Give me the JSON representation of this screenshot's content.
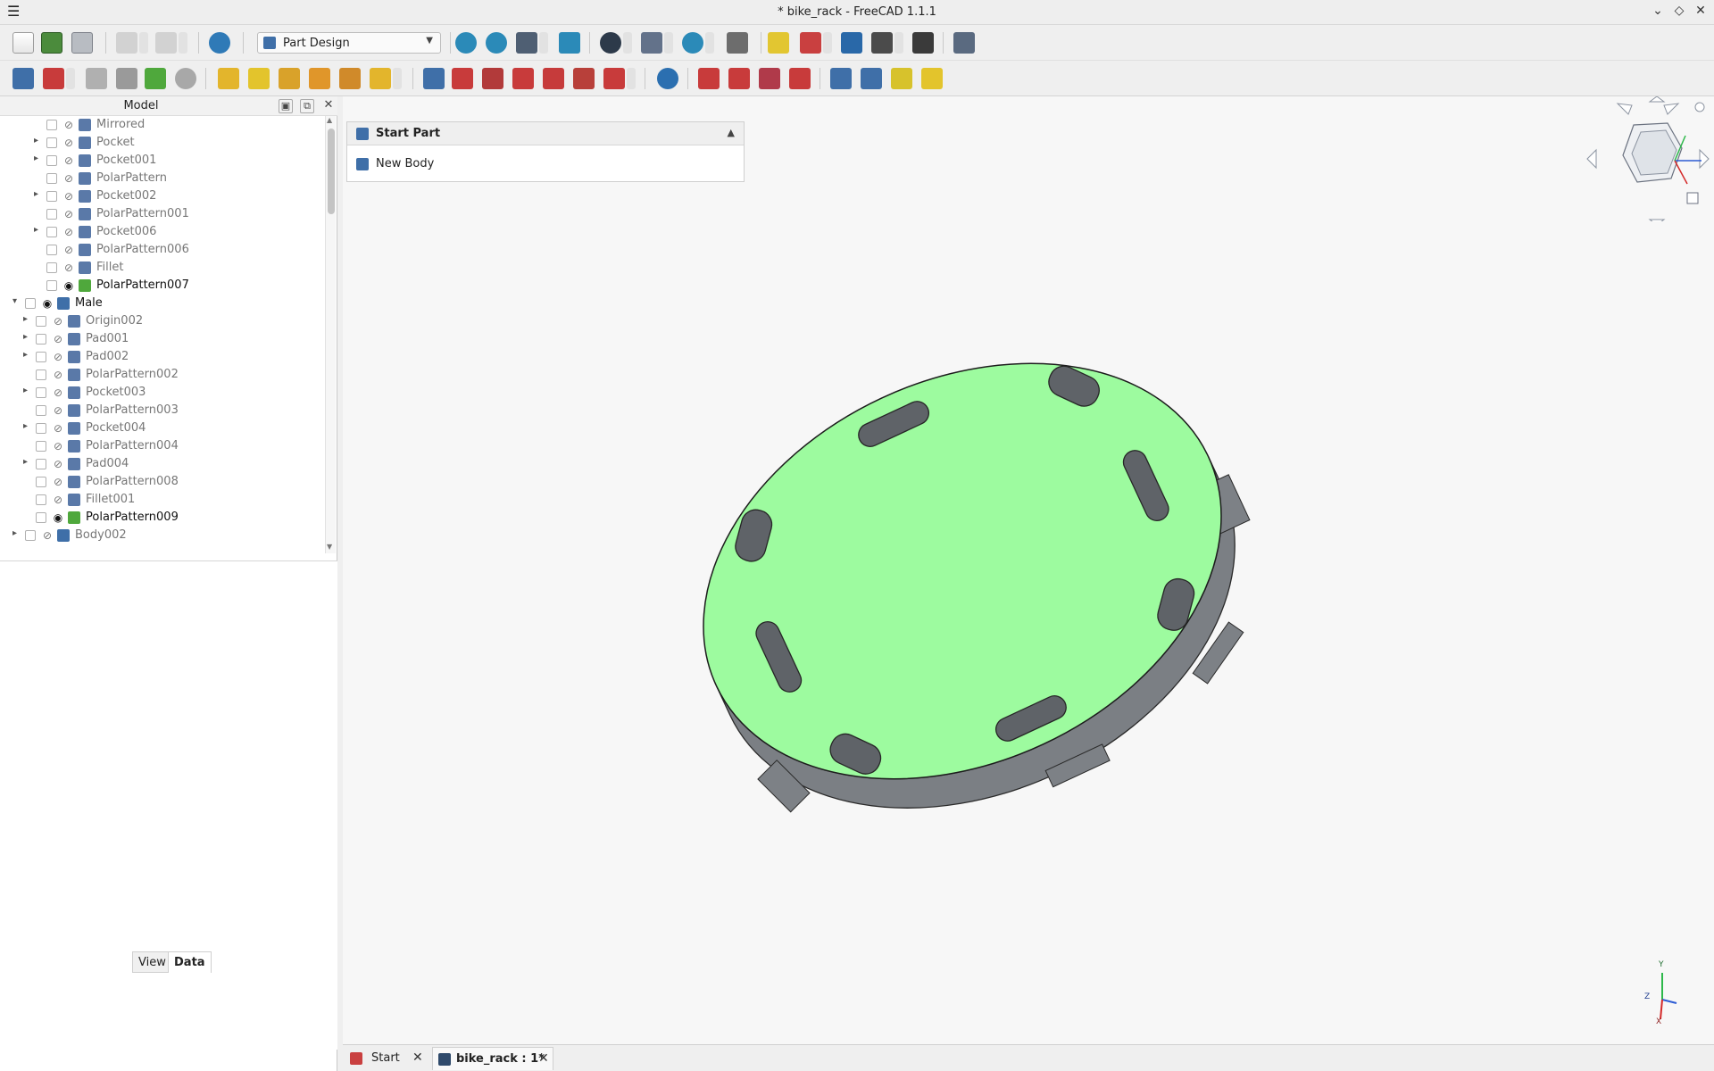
{
  "window": {
    "title": "* bike_rack - FreeCAD 1.1.1",
    "menu_icon": "hamburger-menu-icon",
    "controls": [
      "chevron-down-icon",
      "restore-icon",
      "close-icon"
    ]
  },
  "toolbar": {
    "workbench": "Part Design",
    "file_buttons": [
      "new-file-icon",
      "open-file-icon",
      "save-file-icon"
    ],
    "edit_buttons": [
      "undo-icon",
      "redo-icon",
      "refresh-icon"
    ],
    "view_buttons": [
      "fit-all-icon",
      "fit-selection-icon",
      "view-cube-menu-icon",
      "measure-icon",
      "draw-style-icon",
      "standard-views-icon",
      "zoom-icon",
      "measurement-icon",
      "create-part-icon",
      "create-datum-icon",
      "create-group-icon",
      "link-icon",
      "macro-icon",
      "whats-this-icon"
    ]
  },
  "tree_panel": {
    "title": "Model",
    "items": [
      {
        "label": "Mirrored",
        "depth": 2,
        "expandable": false,
        "visible": false
      },
      {
        "label": "Pocket",
        "depth": 2,
        "expandable": true,
        "visible": false
      },
      {
        "label": "Pocket001",
        "depth": 2,
        "expandable": true,
        "visible": false
      },
      {
        "label": "PolarPattern",
        "depth": 2,
        "expandable": false,
        "visible": false
      },
      {
        "label": "Pocket002",
        "depth": 2,
        "expandable": true,
        "visible": false
      },
      {
        "label": "PolarPattern001",
        "depth": 2,
        "expandable": false,
        "visible": false
      },
      {
        "label": "Pocket006",
        "depth": 2,
        "expandable": true,
        "visible": false
      },
      {
        "label": "PolarPattern006",
        "depth": 2,
        "expandable": false,
        "visible": false
      },
      {
        "label": "Fillet",
        "depth": 2,
        "expandable": false,
        "visible": false
      },
      {
        "label": "PolarPattern007",
        "depth": 2,
        "expandable": false,
        "visible": true,
        "active": true
      },
      {
        "label": "Male",
        "depth": 0,
        "expandable": true,
        "expanded": true,
        "visible": true,
        "active": true,
        "is_body": true
      },
      {
        "label": "Origin002",
        "depth": 1,
        "expandable": true,
        "visible": false
      },
      {
        "label": "Pad001",
        "depth": 1,
        "expandable": true,
        "visible": false
      },
      {
        "label": "Pad002",
        "depth": 1,
        "expandable": true,
        "visible": false
      },
      {
        "label": "PolarPattern002",
        "depth": 1,
        "expandable": false,
        "visible": false
      },
      {
        "label": "Pocket003",
        "depth": 1,
        "expandable": true,
        "visible": false
      },
      {
        "label": "PolarPattern003",
        "depth": 1,
        "expandable": false,
        "visible": false
      },
      {
        "label": "Pocket004",
        "depth": 1,
        "expandable": true,
        "visible": false
      },
      {
        "label": "PolarPattern004",
        "depth": 1,
        "expandable": false,
        "visible": false
      },
      {
        "label": "Pad004",
        "depth": 1,
        "expandable": true,
        "visible": false
      },
      {
        "label": "PolarPattern008",
        "depth": 1,
        "expandable": false,
        "visible": false
      },
      {
        "label": "Fillet001",
        "depth": 1,
        "expandable": false,
        "visible": false
      },
      {
        "label": "PolarPattern009",
        "depth": 1,
        "expandable": false,
        "visible": true,
        "active": true
      },
      {
        "label": "Body002",
        "depth": 0,
        "expandable": true,
        "visible": false,
        "is_body": true
      }
    ]
  },
  "property_tabs": {
    "view": "View",
    "data": "Data",
    "selected": "Data"
  },
  "task_panel": {
    "title": "Start Part",
    "items": [
      "New Body"
    ]
  },
  "document_tabs": [
    {
      "label": "Start",
      "icon": "start-page-icon",
      "selected": false
    },
    {
      "label": "bike_rack : 1*",
      "icon": "document-icon",
      "selected": true
    }
  ],
  "axis_labels": {
    "y": "Y",
    "z": "Z",
    "x": "X"
  },
  "colors": {
    "selected_face": "#9dfb9f",
    "part_body": "#7b7f84",
    "body_icon": "#3f6fa8",
    "axis_x": "#d42a2a",
    "axis_y": "#2db84a",
    "axis_z": "#2d5cd4"
  }
}
